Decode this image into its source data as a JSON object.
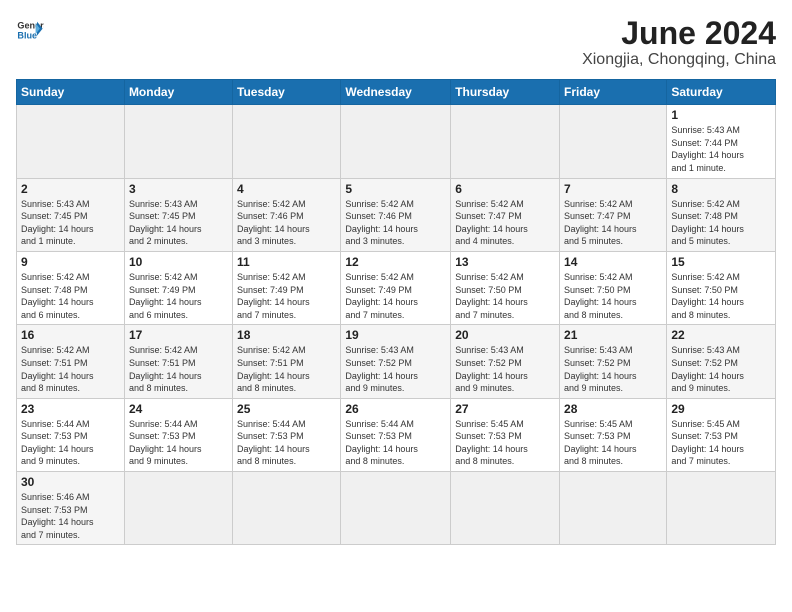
{
  "header": {
    "logo_general": "General",
    "logo_blue": "Blue",
    "month": "June 2024",
    "location": "Xiongjia, Chongqing, China"
  },
  "days_of_week": [
    "Sunday",
    "Monday",
    "Tuesday",
    "Wednesday",
    "Thursday",
    "Friday",
    "Saturday"
  ],
  "weeks": [
    [
      {
        "day": "",
        "info": ""
      },
      {
        "day": "",
        "info": ""
      },
      {
        "day": "",
        "info": ""
      },
      {
        "day": "",
        "info": ""
      },
      {
        "day": "",
        "info": ""
      },
      {
        "day": "",
        "info": ""
      },
      {
        "day": "1",
        "info": "Sunrise: 5:43 AM\nSunset: 7:44 PM\nDaylight: 14 hours\nand 1 minute."
      }
    ],
    [
      {
        "day": "2",
        "info": "Sunrise: 5:43 AM\nSunset: 7:45 PM\nDaylight: 14 hours\nand 1 minute."
      },
      {
        "day": "3",
        "info": "Sunrise: 5:43 AM\nSunset: 7:45 PM\nDaylight: 14 hours\nand 2 minutes."
      },
      {
        "day": "4",
        "info": "Sunrise: 5:42 AM\nSunset: 7:46 PM\nDaylight: 14 hours\nand 3 minutes."
      },
      {
        "day": "5",
        "info": "Sunrise: 5:42 AM\nSunset: 7:46 PM\nDaylight: 14 hours\nand 3 minutes."
      },
      {
        "day": "6",
        "info": "Sunrise: 5:42 AM\nSunset: 7:47 PM\nDaylight: 14 hours\nand 4 minutes."
      },
      {
        "day": "7",
        "info": "Sunrise: 5:42 AM\nSunset: 7:47 PM\nDaylight: 14 hours\nand 5 minutes."
      },
      {
        "day": "8",
        "info": "Sunrise: 5:42 AM\nSunset: 7:48 PM\nDaylight: 14 hours\nand 5 minutes."
      }
    ],
    [
      {
        "day": "9",
        "info": "Sunrise: 5:42 AM\nSunset: 7:48 PM\nDaylight: 14 hours\nand 6 minutes."
      },
      {
        "day": "10",
        "info": "Sunrise: 5:42 AM\nSunset: 7:49 PM\nDaylight: 14 hours\nand 6 minutes."
      },
      {
        "day": "11",
        "info": "Sunrise: 5:42 AM\nSunset: 7:49 PM\nDaylight: 14 hours\nand 7 minutes."
      },
      {
        "day": "12",
        "info": "Sunrise: 5:42 AM\nSunset: 7:49 PM\nDaylight: 14 hours\nand 7 minutes."
      },
      {
        "day": "13",
        "info": "Sunrise: 5:42 AM\nSunset: 7:50 PM\nDaylight: 14 hours\nand 7 minutes."
      },
      {
        "day": "14",
        "info": "Sunrise: 5:42 AM\nSunset: 7:50 PM\nDaylight: 14 hours\nand 8 minutes."
      },
      {
        "day": "15",
        "info": "Sunrise: 5:42 AM\nSunset: 7:50 PM\nDaylight: 14 hours\nand 8 minutes."
      }
    ],
    [
      {
        "day": "16",
        "info": "Sunrise: 5:42 AM\nSunset: 7:51 PM\nDaylight: 14 hours\nand 8 minutes."
      },
      {
        "day": "17",
        "info": "Sunrise: 5:42 AM\nSunset: 7:51 PM\nDaylight: 14 hours\nand 8 minutes."
      },
      {
        "day": "18",
        "info": "Sunrise: 5:42 AM\nSunset: 7:51 PM\nDaylight: 14 hours\nand 8 minutes."
      },
      {
        "day": "19",
        "info": "Sunrise: 5:43 AM\nSunset: 7:52 PM\nDaylight: 14 hours\nand 9 minutes."
      },
      {
        "day": "20",
        "info": "Sunrise: 5:43 AM\nSunset: 7:52 PM\nDaylight: 14 hours\nand 9 minutes."
      },
      {
        "day": "21",
        "info": "Sunrise: 5:43 AM\nSunset: 7:52 PM\nDaylight: 14 hours\nand 9 minutes."
      },
      {
        "day": "22",
        "info": "Sunrise: 5:43 AM\nSunset: 7:52 PM\nDaylight: 14 hours\nand 9 minutes."
      }
    ],
    [
      {
        "day": "23",
        "info": "Sunrise: 5:44 AM\nSunset: 7:53 PM\nDaylight: 14 hours\nand 9 minutes."
      },
      {
        "day": "24",
        "info": "Sunrise: 5:44 AM\nSunset: 7:53 PM\nDaylight: 14 hours\nand 9 minutes."
      },
      {
        "day": "25",
        "info": "Sunrise: 5:44 AM\nSunset: 7:53 PM\nDaylight: 14 hours\nand 8 minutes."
      },
      {
        "day": "26",
        "info": "Sunrise: 5:44 AM\nSunset: 7:53 PM\nDaylight: 14 hours\nand 8 minutes."
      },
      {
        "day": "27",
        "info": "Sunrise: 5:45 AM\nSunset: 7:53 PM\nDaylight: 14 hours\nand 8 minutes."
      },
      {
        "day": "28",
        "info": "Sunrise: 5:45 AM\nSunset: 7:53 PM\nDaylight: 14 hours\nand 8 minutes."
      },
      {
        "day": "29",
        "info": "Sunrise: 5:45 AM\nSunset: 7:53 PM\nDaylight: 14 hours\nand 7 minutes."
      }
    ],
    [
      {
        "day": "30",
        "info": "Sunrise: 5:46 AM\nSunset: 7:53 PM\nDaylight: 14 hours\nand 7 minutes."
      },
      {
        "day": "",
        "info": ""
      },
      {
        "day": "",
        "info": ""
      },
      {
        "day": "",
        "info": ""
      },
      {
        "day": "",
        "info": ""
      },
      {
        "day": "",
        "info": ""
      },
      {
        "day": "",
        "info": ""
      }
    ]
  ]
}
